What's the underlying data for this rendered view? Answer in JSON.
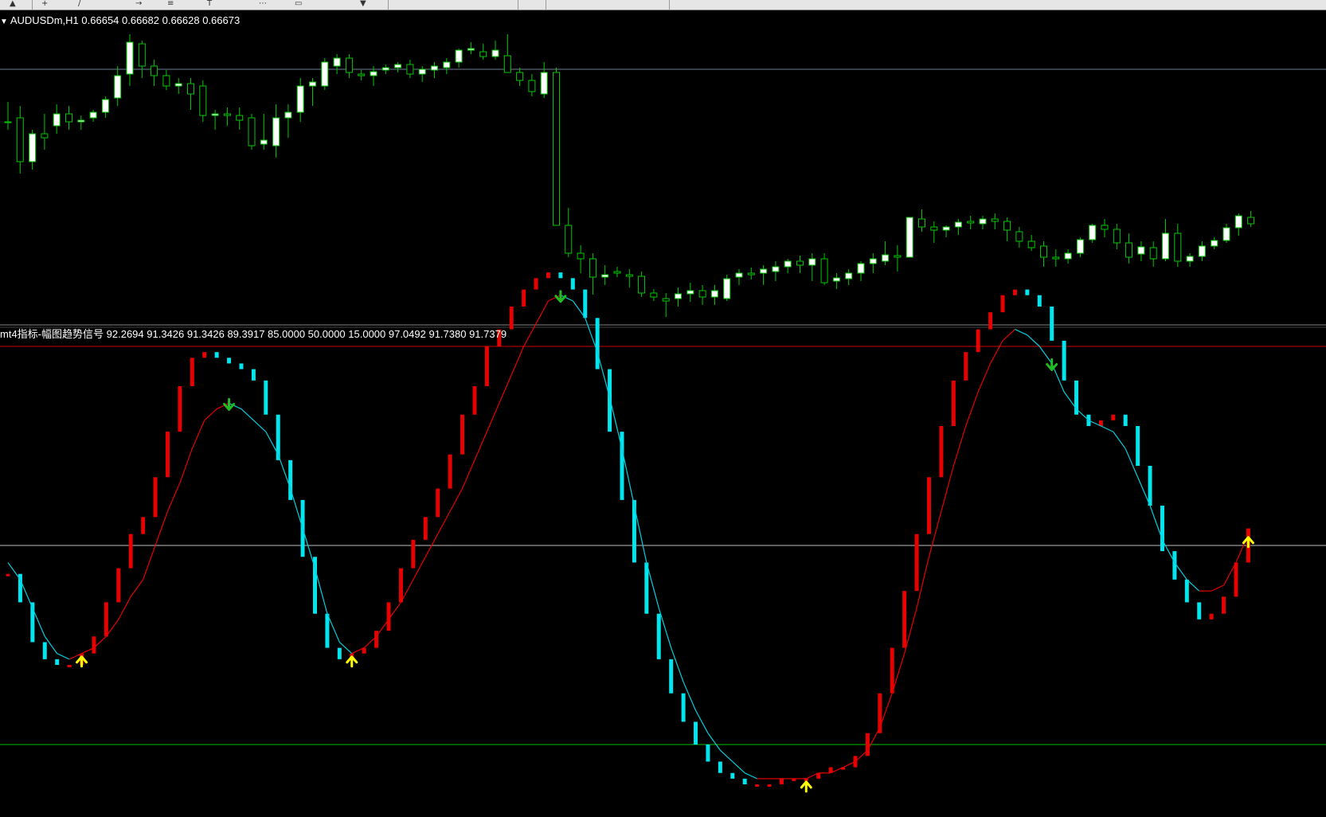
{
  "toolbar": {
    "icons": [
      "cursor-icon",
      "crosshair-icon",
      "line-icon",
      "arrow-icon",
      "period-icon",
      "text-icon",
      "grid-icon"
    ]
  },
  "price_panel": {
    "symbol": "AUDUSDm,H1",
    "ohlc": "0.66654 0.66682 0.66628 0.66673",
    "caret": "▼"
  },
  "indicator_panel": {
    "name": "mt4指标-幅图趋势信号",
    "values": "92.2694 91.3426 91.3426 89.3917 85.0000 50.0000 15.0000 97.0492 91.7380 91.7379"
  },
  "colors": {
    "background": "#000000",
    "bull_candle_body": "#ffffff",
    "candle_wick": "#00c800",
    "bar_up": "#e60000",
    "bar_down": "#00e5ee",
    "signal_line_up": "#e60000",
    "signal_line_down": "#00cfe0",
    "buy_arrow": "#ffff00",
    "sell_arrow": "#22bb22",
    "level_85": "#cc0000",
    "level_50": "#c0c0c0",
    "level_15": "#00c000"
  },
  "chart_data": [
    {
      "type": "candlestick",
      "symbol": "AUDUSDm",
      "timeframe": "H1",
      "ohlc_current": [
        0.66654,
        0.66682,
        0.66628,
        0.66673
      ],
      "horizontal_line": "level near the upper session range",
      "note": "approximately 105 hourly candles; sharp single-bar drop near the middle"
    },
    {
      "type": "bar",
      "title": "mt4指标-幅图趋势信号",
      "ylim": [
        15,
        85
      ],
      "levels": [
        85,
        50,
        15
      ],
      "buffer_values": [
        92.2694,
        91.3426,
        91.3426,
        89.3917,
        85.0,
        50.0,
        15.0,
        97.0492,
        91.738,
        91.7379
      ],
      "series": [
        {
          "values": [
            45,
            40,
            33,
            30,
            29,
            29,
            31,
            34,
            40,
            46,
            52,
            55,
            62,
            70,
            78,
            83,
            84,
            83,
            82,
            81,
            79,
            73,
            65,
            58,
            48,
            38,
            32,
            30,
            31,
            32,
            35,
            40,
            46,
            51,
            55,
            60,
            66,
            73,
            78,
            85,
            88,
            92,
            95,
            97,
            98,
            97,
            95,
            90,
            81,
            70,
            58,
            47,
            38,
            30,
            24,
            19,
            15,
            12,
            10,
            9,
            8,
            8,
            8,
            9,
            9,
            9,
            10,
            11,
            11,
            13,
            17,
            24,
            32,
            42,
            52,
            62,
            71,
            79,
            84,
            88,
            91,
            94,
            95,
            94,
            92,
            86,
            79,
            73,
            71,
            72,
            73,
            71,
            64,
            57,
            49,
            44,
            40,
            37,
            38,
            41,
            47,
            53
          ]
        },
        {
          "name": "signal",
          "values": [
            47,
            44,
            39,
            34,
            31,
            30,
            31,
            32,
            34,
            37,
            41,
            44,
            50,
            56,
            61,
            67,
            72,
            74,
            75,
            74,
            72,
            70,
            66,
            60,
            53,
            46,
            38,
            33,
            31,
            32,
            34,
            37,
            40,
            44,
            48,
            52,
            56,
            60,
            65,
            70,
            75,
            80,
            85,
            89,
            93,
            94,
            93,
            90,
            84,
            76,
            67,
            57,
            47,
            39,
            32,
            26,
            21,
            17,
            14,
            12,
            10,
            9,
            9,
            9,
            9,
            9,
            10,
            10,
            11,
            12,
            14,
            18,
            24,
            31,
            39,
            48,
            56,
            64,
            71,
            77,
            82,
            86,
            88,
            87,
            85,
            82,
            77,
            74,
            72,
            71,
            70,
            67,
            62,
            57,
            51,
            47,
            44,
            42,
            42,
            43,
            47,
            52
          ]
        }
      ],
      "buy_signals_at_index": [
        6,
        28,
        65,
        101
      ],
      "sell_signals_at_index": [
        18,
        45,
        85
      ]
    }
  ]
}
